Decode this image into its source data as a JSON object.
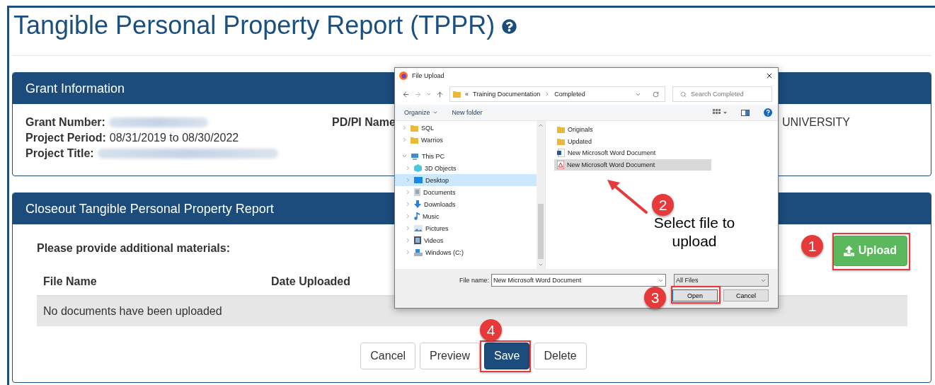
{
  "page": {
    "title": "Tangible Personal Property Report (TPPR)"
  },
  "grant_panel": {
    "heading": "Grant Information",
    "fields": [
      {
        "label": "Grant Number:",
        "kind": "blurred"
      },
      {
        "label": "Project Period:",
        "kind": "text",
        "value": "08/31/2019 to 08/30/2022"
      },
      {
        "label": "Project Title:",
        "kind": "blurred"
      }
    ],
    "side_label": "PD/PI Name",
    "side_value": "UNIVERSITY"
  },
  "closeout_panel": {
    "heading": "Closeout Tangible Personal Property Report",
    "prompt": "Please provide additional materials:",
    "upload_button": "Upload",
    "columns": [
      "File Name",
      "Date Uploaded"
    ],
    "empty_message": "No documents have been uploaded",
    "actions": [
      {
        "label": "Cancel",
        "kind": "default"
      },
      {
        "label": "Preview",
        "kind": "default"
      },
      {
        "label": "Save",
        "kind": "primary"
      },
      {
        "label": "Delete",
        "kind": "default"
      }
    ]
  },
  "dialog": {
    "title": "File Upload",
    "path_prefix": "«",
    "path": [
      "Training Documentation",
      "Completed"
    ],
    "search": {
      "placeholder": "Search Completed"
    },
    "toolbar": [
      "Organize",
      "New folder"
    ],
    "nav": [
      {
        "label": "SQL",
        "kind": "folder",
        "expanded": false,
        "selected": false
      },
      {
        "label": "Warrios",
        "kind": "folder",
        "expanded": false,
        "selected": false
      },
      {
        "label": "This PC",
        "kind": "pc",
        "expanded": true,
        "selected": false,
        "children": [
          {
            "label": "3D Objects",
            "kind": "cube",
            "expanded": false,
            "selected": false
          },
          {
            "label": "Desktop",
            "kind": "desktop",
            "expanded": false,
            "selected": true
          },
          {
            "label": "Documents",
            "kind": "documents",
            "expanded": false,
            "selected": false
          },
          {
            "label": "Downloads",
            "kind": "downloads",
            "expanded": false,
            "selected": false
          },
          {
            "label": "Music",
            "kind": "music",
            "expanded": false,
            "selected": false
          },
          {
            "label": "Pictures",
            "kind": "pictures",
            "expanded": false,
            "selected": false
          },
          {
            "label": "Videos",
            "kind": "videos",
            "expanded": false,
            "selected": false
          },
          {
            "label": "Windows (C:)",
            "kind": "drive",
            "expanded": false,
            "selected": false
          }
        ]
      }
    ],
    "files": [
      {
        "name": "Originals",
        "kind": "folder",
        "selected": false
      },
      {
        "name": "Updated",
        "kind": "folder",
        "selected": false
      },
      {
        "name": "New Microsoft Word Document",
        "kind": "word",
        "selected": false
      },
      {
        "name": "New Microsoft Word Document",
        "kind": "pdf",
        "selected": true
      }
    ],
    "file_name_label": "File name:",
    "file_name": "New Microsoft Word Document",
    "file_type": "All Files",
    "buttons": [
      "Open",
      "Cancel"
    ]
  },
  "steps": [
    {
      "number": "1"
    },
    {
      "number": "2",
      "caption": "Select file to upload"
    },
    {
      "number": "3"
    },
    {
      "number": "4"
    }
  ]
}
